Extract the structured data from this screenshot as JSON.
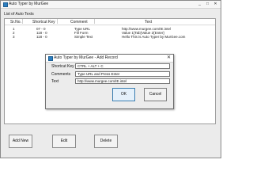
{
  "window": {
    "title": "Auto Typer by MurGee",
    "minimize_label": "_",
    "maximize_label": "□",
    "close_label": "✕"
  },
  "list": {
    "group_label": "List of Auto Texts",
    "columns": [
      "Sr.No.",
      "Shortcut Key",
      "Comment",
      "Text"
    ],
    "rows": [
      {
        "sr": "1",
        "shortcut": "07 - 0",
        "comment": "Type URL",
        "text": "http://www.murgee.com/IE.intel"
      },
      {
        "sr": "2",
        "shortcut": "118 - 0",
        "comment": "Fill Form",
        "text": "Value 1{Tab}Value 2{Enter}"
      },
      {
        "sr": "3",
        "shortcut": "118 - 0",
        "comment": "Simple Text",
        "text": "Hello This is Auto Typer by MurGee.com"
      }
    ]
  },
  "buttons": {
    "add_new": "Add New",
    "edit": "Edit",
    "delete": "Delete"
  },
  "dialog": {
    "title": "Auto Typer by MurGee - Add Record",
    "close_label": "✕",
    "shortcut_label": "Shortcut Key",
    "shortcut_value": "CTRL + ALT + C",
    "comments_label": "Comments",
    "comments_value": "Type URL and Press Enter",
    "text_label": "Text",
    "text_value": "http://www.murgee.com/IE.intel",
    "ok_label": "OK",
    "cancel_label": "Cancel"
  }
}
